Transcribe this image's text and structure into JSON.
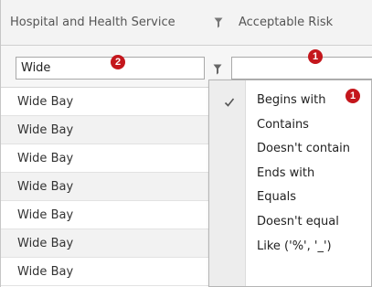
{
  "header": {
    "col_hospital": "Hospital and Health Service",
    "col_risk": "Acceptable Risk"
  },
  "filters": {
    "hospital_value": "Wide",
    "risk_value": ""
  },
  "badges": {
    "risk_filter": "1",
    "hospital_filter": "2",
    "begins_with": "1"
  },
  "rows": [
    {
      "hospital": "Wide Bay"
    },
    {
      "hospital": "Wide Bay"
    },
    {
      "hospital": "Wide Bay"
    },
    {
      "hospital": "Wide Bay"
    },
    {
      "hospital": "Wide Bay"
    },
    {
      "hospital": "Wide Bay"
    },
    {
      "hospital": "Wide Bay"
    }
  ],
  "filter_menu": {
    "selected_index": 0,
    "check_glyph": "✓",
    "items": [
      {
        "label": "Begins with"
      },
      {
        "label": "Contains"
      },
      {
        "label": "Doesn't contain"
      },
      {
        "label": "Ends with"
      },
      {
        "label": "Equals"
      },
      {
        "label": "Doesn't equal"
      },
      {
        "label": "Like ('%', '_')"
      }
    ]
  },
  "colors": {
    "badge_red": "#c4161c",
    "header_bg": "#f3f3f3",
    "alt_row_bg": "#f2f2f2",
    "menu_check_col": "#ededed"
  },
  "icons": {
    "header_filter": "funnel-icon",
    "row_filter": "funnel-icon",
    "selected_option": "checkmark-icon"
  }
}
